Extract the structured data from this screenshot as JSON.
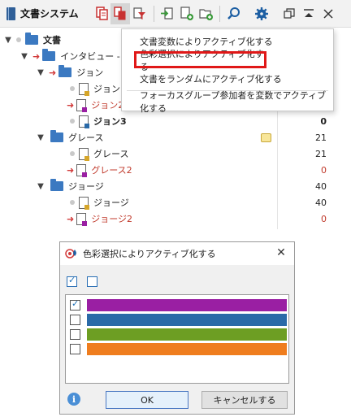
{
  "toolbar": {
    "title": "文書システム",
    "icons": [
      "doc-stack-icon",
      "copy-icon",
      "filter-icon",
      "import-icon",
      "new-doc-icon",
      "new-folder-icon",
      "search-icon",
      "gear-icon",
      "window-restore-icon",
      "collapse-icon",
      "close-icon"
    ]
  },
  "tree": {
    "root": "文書",
    "set": "インタビュー - ニュ",
    "groups": [
      {
        "name": "ジョン",
        "docs": [
          {
            "name": "ジョン",
            "num": "",
            "red": false,
            "bold": false
          },
          {
            "name": "ジョン2",
            "num": "",
            "red": true,
            "bold": false
          },
          {
            "name": "ジョン3",
            "num": "0",
            "red": false,
            "bold": true
          }
        ]
      },
      {
        "name": "グレース",
        "num": "21",
        "docs": [
          {
            "name": "グレース",
            "num": "21",
            "red": false,
            "bold": false
          },
          {
            "name": "グレース2",
            "num": "0",
            "red": true,
            "bold": false
          }
        ]
      },
      {
        "name": "ジョージ",
        "num": "40",
        "docs": [
          {
            "name": "ジョージ",
            "num": "40",
            "red": false,
            "bold": false
          },
          {
            "name": "ジョージ2",
            "num": "0",
            "red": true,
            "bold": false
          }
        ]
      }
    ]
  },
  "menu": {
    "items": [
      "文書変数によりアクティブ化する",
      "色彩選択によりアクティブ化する",
      "文書をランダムにアクティブ化する",
      "フォーカスグループ参加者を変数でアクティブ化する"
    ]
  },
  "dialog": {
    "title": "色彩選択によりアクティブ化する",
    "colors": [
      {
        "hex": "#9a1fa3",
        "checked": true
      },
      {
        "hex": "#2a6aa8",
        "checked": false
      },
      {
        "hex": "#6d9e23",
        "checked": false
      },
      {
        "hex": "#ef7d1e",
        "checked": false
      }
    ],
    "ok": "OK",
    "cancel": "キャンセルする"
  },
  "colors": {
    "highlight_border": "#e01818",
    "folder": "#3b79c1",
    "red_text": "#c0392b"
  }
}
